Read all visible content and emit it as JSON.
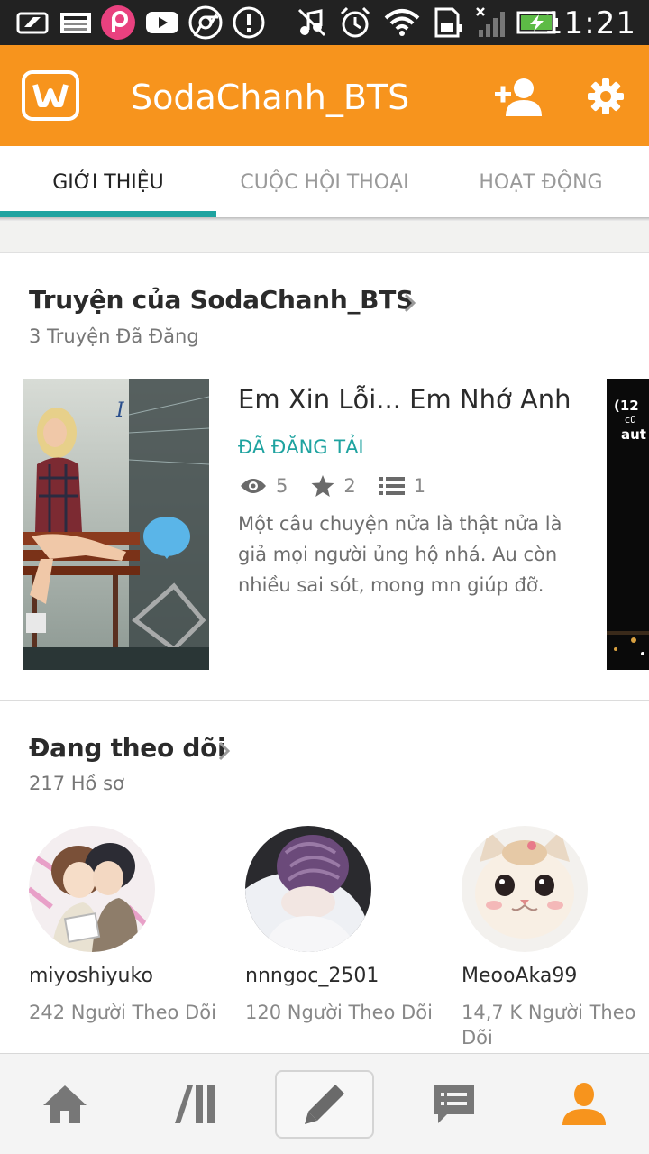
{
  "status_bar": {
    "time": "11:21",
    "icons": [
      "screenshot-icon",
      "image-icon",
      "picsart-icon",
      "youtube-icon",
      "chrome-icon",
      "alert-icon",
      "music-muted-icon",
      "alarm-icon",
      "wifi-icon",
      "sd-card-icon",
      "signal-icon",
      "battery-charging-icon"
    ]
  },
  "app_bar": {
    "logo": "wattpad-logo",
    "title": "SodaChanh_BTS",
    "actions": [
      "add-friend-icon",
      "settings-icon"
    ],
    "color": "#f7941d"
  },
  "tabs": [
    {
      "label": "GIỚI THIỆU",
      "active": true
    },
    {
      "label": "CUỘC HỘI THOẠI",
      "active": false
    },
    {
      "label": "HOẠT ĐỘNG",
      "active": false
    }
  ],
  "accent_color": "#1fa3a0",
  "stories_section": {
    "title": "Truyện của SodaChanh_BTS",
    "subtitle": "3 Truyện Đã Đăng",
    "story": {
      "title": "Em Xin Lỗi... Em Nhớ Anh",
      "status": "ĐÃ ĐĂNG TẢI",
      "views": "5",
      "votes": "2",
      "parts": "1",
      "description": "Một câu chuyện nửa là thật nửa là giả mọi người ủng hộ nhá. Au còn nhiều sai sót, mong mn giúp đỡ."
    },
    "next_cover_text": [
      "(12",
      "cũ",
      "aut"
    ]
  },
  "following_section": {
    "title": "Đang theo dõi",
    "subtitle": "217 Hồ sơ",
    "profiles": [
      {
        "name": "miyoshiyuko",
        "followers": "242 Người Theo Dõi"
      },
      {
        "name": "nnngoc_2501",
        "followers": "120 Người Theo Dõi"
      },
      {
        "name": "MeooAka99",
        "followers": "14,7 K Người Theo Dõi"
      }
    ]
  },
  "bottom_nav": [
    "home-icon",
    "library-icon",
    "write-icon",
    "messages-icon",
    "profile-icon"
  ]
}
